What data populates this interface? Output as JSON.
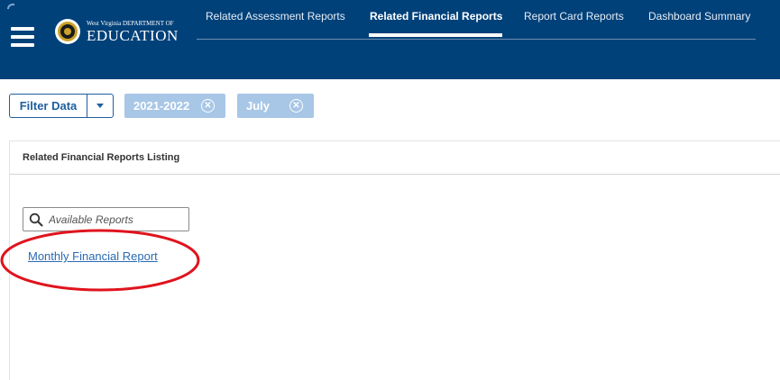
{
  "header": {
    "logo": {
      "small_text": "West Virginia DEPARTMENT OF",
      "big_text": "EDUCATION"
    },
    "nav_tabs": [
      {
        "label": "Related Assessment Reports",
        "active": false
      },
      {
        "label": "Related Financial Reports",
        "active": true
      },
      {
        "label": "Report Card Reports",
        "active": false
      },
      {
        "label": "Dashboard Summary",
        "active": false
      }
    ]
  },
  "filters": {
    "button_label": "Filter Data",
    "chips": [
      {
        "label": "2021-2022"
      },
      {
        "label": "July"
      }
    ]
  },
  "listing": {
    "title": "Related Financial Reports Listing",
    "search_placeholder": "Available Reports",
    "reports": [
      "Monthly Financial Report"
    ]
  },
  "colors": {
    "header_bg": "#00417a",
    "accent": "#1f5fa0",
    "chip_bg": "#a8c6e6",
    "link": "#2a6ab3",
    "annotation": "#e0141e"
  },
  "icons": [
    "hamburger-icon",
    "wv-seal-icon",
    "chevron-down-icon",
    "close-circle-icon",
    "search-icon"
  ]
}
